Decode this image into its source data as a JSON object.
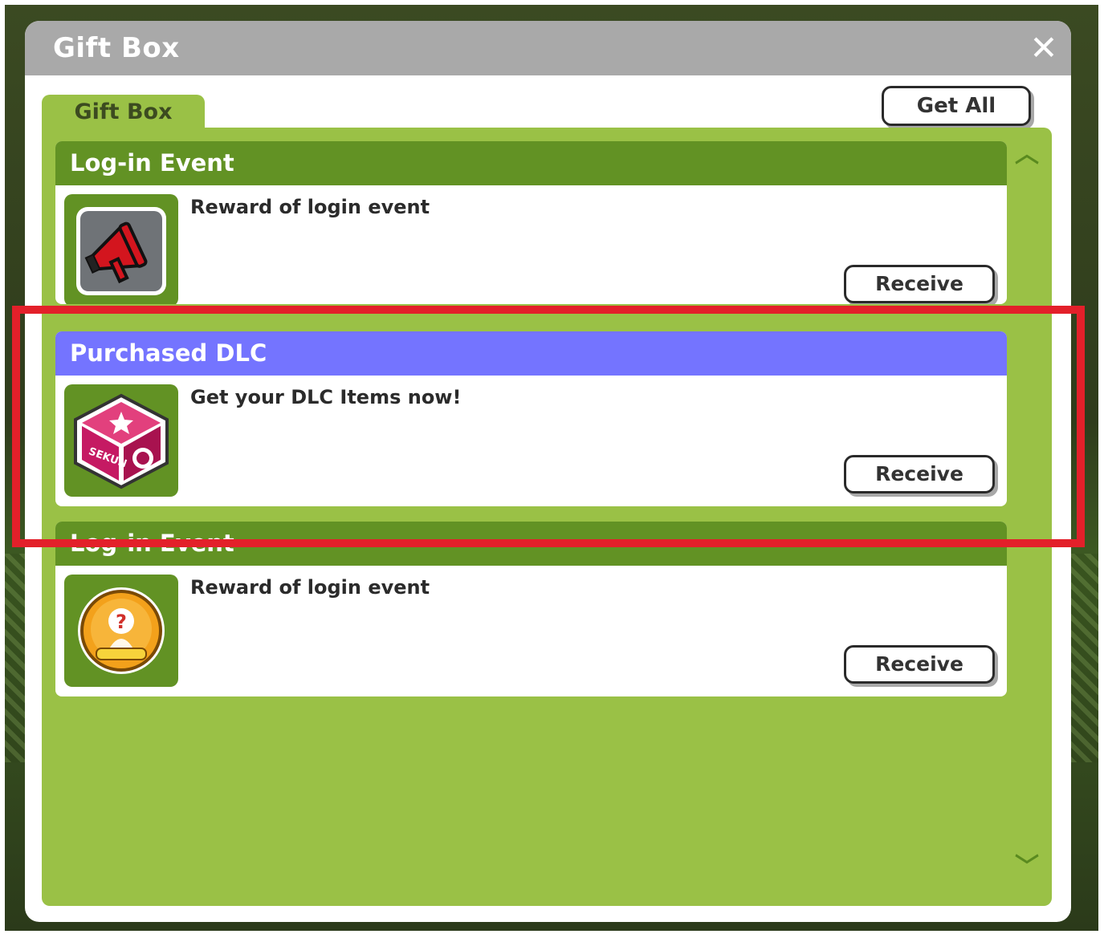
{
  "window": {
    "title": "Gift Box",
    "close_icon": "close-icon"
  },
  "tabs": [
    {
      "label": "Gift Box",
      "active": true
    }
  ],
  "toolbar": {
    "get_all_label": "Get All"
  },
  "gifts": [
    {
      "header": "Log-in Event",
      "header_color": "#629224",
      "description": "Reward of login event",
      "icon": "megaphone-icon",
      "button_label": "Receive"
    },
    {
      "header": "Purchased DLC",
      "header_color": "#7474ff",
      "description": "Get your DLC Items now!",
      "icon": "gift-box-icon",
      "icon_text": "SEKUN",
      "button_label": "Receive",
      "highlighted": true
    },
    {
      "header": "Log-in Event",
      "header_color": "#629224",
      "description": "Reward of login event",
      "icon": "question-medal-icon",
      "button_label": "Receive"
    }
  ],
  "scroll": {
    "up_icon": "chevron-up-icon",
    "down_icon": "chevron-down-icon"
  },
  "colors": {
    "panel_green": "#9ac146",
    "header_green": "#629224",
    "dlc_purple": "#7474ff",
    "highlight_red": "#e3202a",
    "titlebar_gray": "#a9a9a9"
  }
}
